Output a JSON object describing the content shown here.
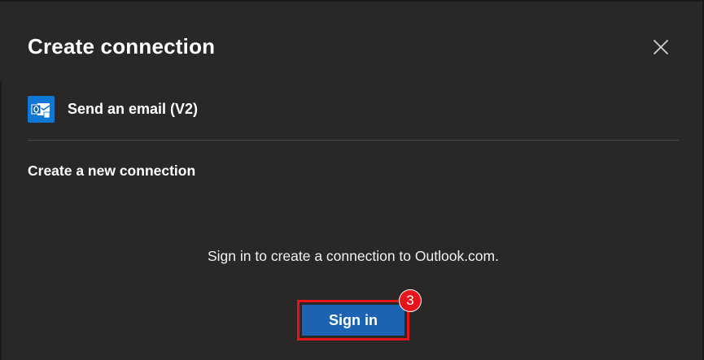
{
  "dialog": {
    "title": "Create connection",
    "close_icon": "close-icon"
  },
  "action": {
    "icon": "outlook-icon",
    "label": "Send an email (V2)"
  },
  "section": {
    "title": "Create a new connection"
  },
  "signin": {
    "hint": "Sign in to create a connection to Outlook.com.",
    "button_label": "Sign in",
    "step_badge": "3"
  },
  "colors": {
    "background": "#292827",
    "primary_button": "#1c64b3",
    "highlight": "#e8141c",
    "divider": "#4a4847"
  }
}
